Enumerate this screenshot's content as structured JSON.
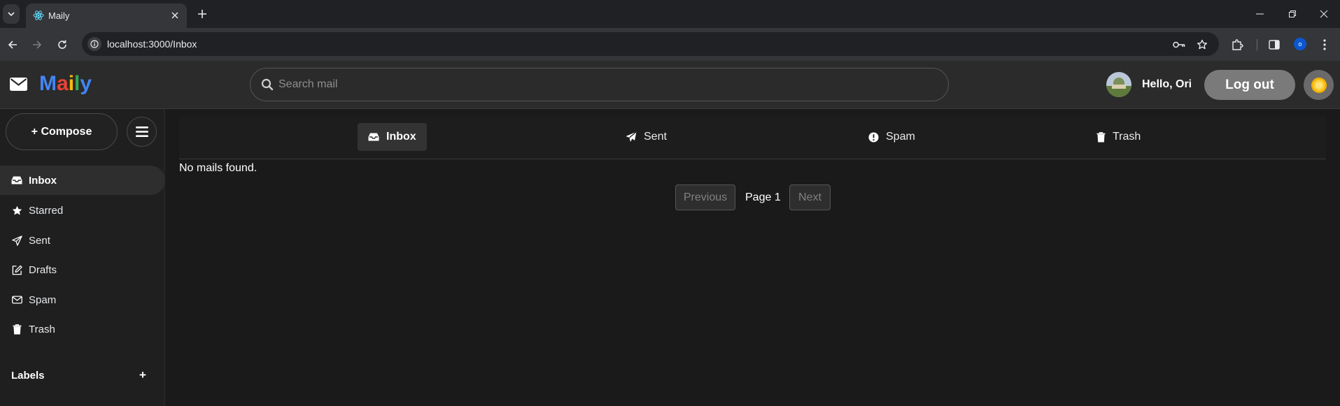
{
  "browser": {
    "tab_title": "Maily",
    "url": "localhost:3000/Inbox",
    "profile_initial": "o"
  },
  "header": {
    "logo_letters": [
      {
        "char": "M",
        "color": "#4285f4"
      },
      {
        "char": "a",
        "color": "#ea4335"
      },
      {
        "char": "i",
        "color": "#fbbc05"
      },
      {
        "char": "l",
        "color": "#34a853"
      },
      {
        "char": "y",
        "color": "#4285f4"
      }
    ],
    "search_placeholder": "Search mail",
    "greeting": "Hello, Ori",
    "logout_label": "Log out"
  },
  "sidebar": {
    "compose_label": "+ Compose",
    "items": [
      {
        "label": "Inbox",
        "icon": "inbox-icon",
        "active": true
      },
      {
        "label": "Starred",
        "icon": "star-icon",
        "active": false
      },
      {
        "label": "Sent",
        "icon": "send-icon",
        "active": false
      },
      {
        "label": "Drafts",
        "icon": "edit-icon",
        "active": false
      },
      {
        "label": "Spam",
        "icon": "envelope-icon",
        "active": false
      },
      {
        "label": "Trash",
        "icon": "trash-icon",
        "active": false
      }
    ],
    "labels_title": "Labels",
    "labels_add": "+"
  },
  "main": {
    "tabs": [
      {
        "label": "Inbox",
        "icon": "inbox-icon",
        "active": true
      },
      {
        "label": "Sent",
        "icon": "send-icon",
        "active": false
      },
      {
        "label": "Spam",
        "icon": "alert-icon",
        "active": false
      },
      {
        "label": "Trash",
        "icon": "trash-icon",
        "active": false
      }
    ],
    "empty_message": "No mails found.",
    "pager": {
      "previous_label": "Previous",
      "page_label": "Page 1",
      "next_label": "Next"
    }
  },
  "colors": {
    "background": "#1a1a1a",
    "header": "#2b2b2b",
    "logout_button": "#7a7a7a"
  }
}
